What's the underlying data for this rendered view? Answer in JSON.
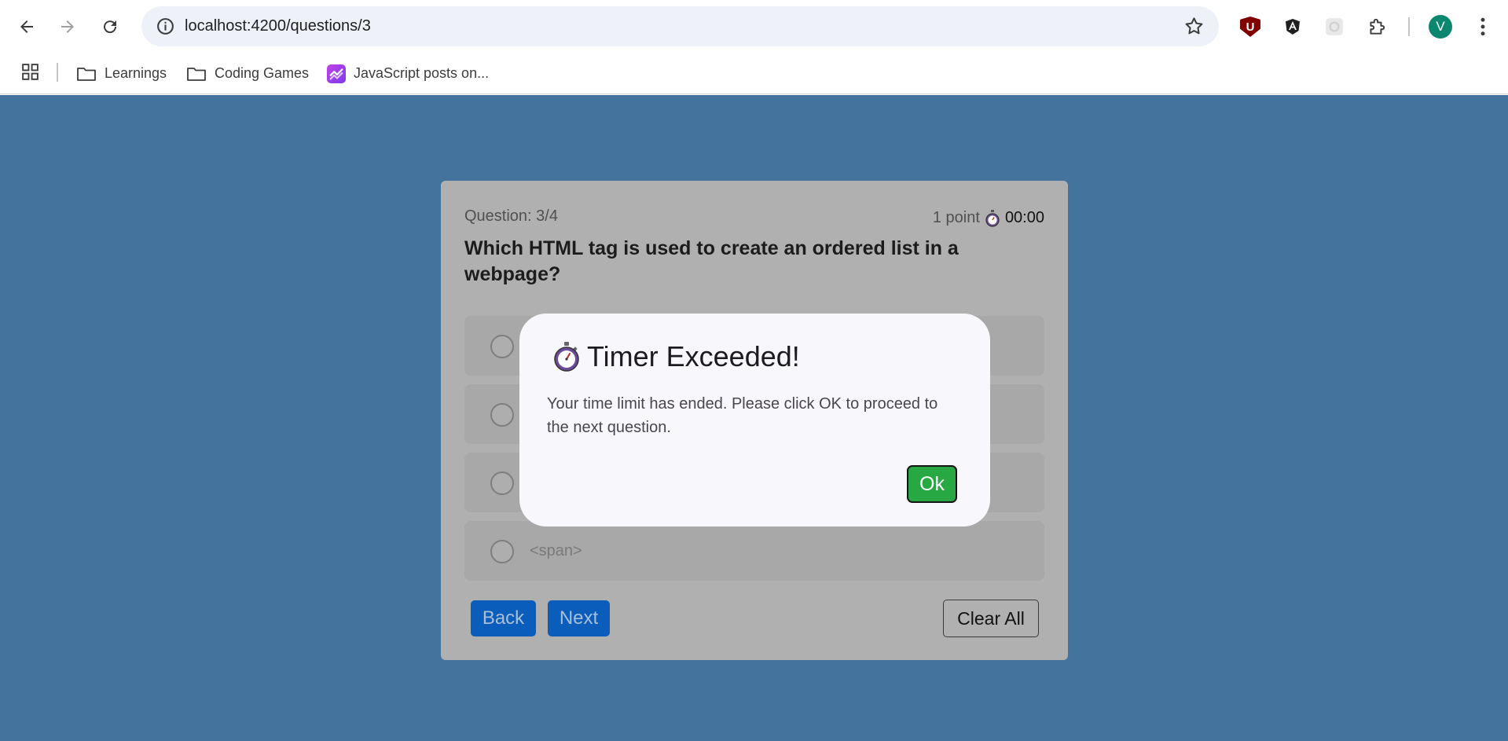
{
  "browser": {
    "url": "localhost:4200/questions/3",
    "avatar_letter": "V",
    "ublock_letter": "U",
    "bookmarks": [
      {
        "label": "Learnings",
        "icon": "folder-icon"
      },
      {
        "label": "Coding Games",
        "icon": "folder-icon"
      },
      {
        "label": "JavaScript posts on...",
        "icon": "site-favicon"
      }
    ]
  },
  "quiz": {
    "question_count": "Question: 3/4",
    "points": "1 point",
    "timer": "00:00",
    "question": "Which HTML tag is used to create an ordered list in a webpage?",
    "options": [
      "",
      "",
      "",
      "<span>"
    ],
    "back_label": "Back",
    "next_label": "Next",
    "clear_label": "Clear All"
  },
  "modal": {
    "title": "Timer Exceeded!",
    "body": "Your time limit has ended. Please click OK to proceed to the next question.",
    "ok_label": "Ok"
  },
  "colors": {
    "page_background": "#44739d",
    "card_overlay": "#b0b0b0",
    "primary_button": "#0a5dbb",
    "ok_button": "#27a843",
    "avatar": "#0b8770"
  }
}
